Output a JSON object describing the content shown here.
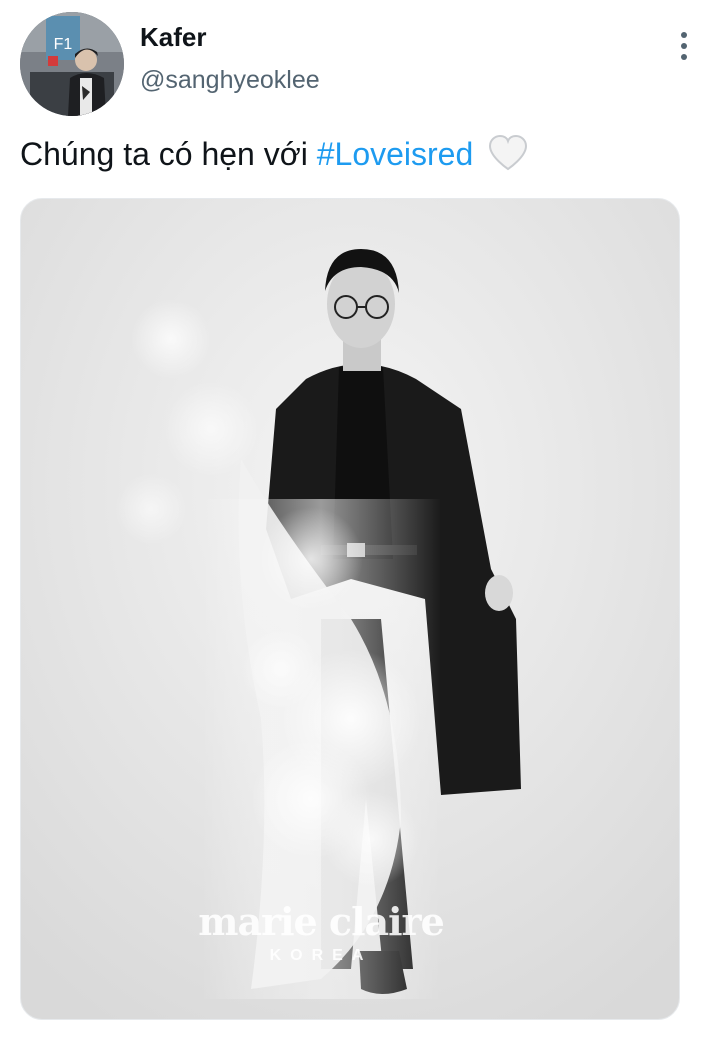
{
  "author": {
    "display_name": "Kafer",
    "handle": "@sanghyeoklee",
    "avatar_sign_text": "F1"
  },
  "tweet": {
    "text": "Chúng ta có hẹn với",
    "hashtag": "#Loveisred",
    "emoji": "white-heart",
    "hashtag_color": "#1d9bf0"
  },
  "media": {
    "watermark_brand": "marie claire",
    "watermark_sub": "KOREA"
  },
  "icons": {
    "more": "more-vertical-icon",
    "heart": "white-heart-icon"
  }
}
